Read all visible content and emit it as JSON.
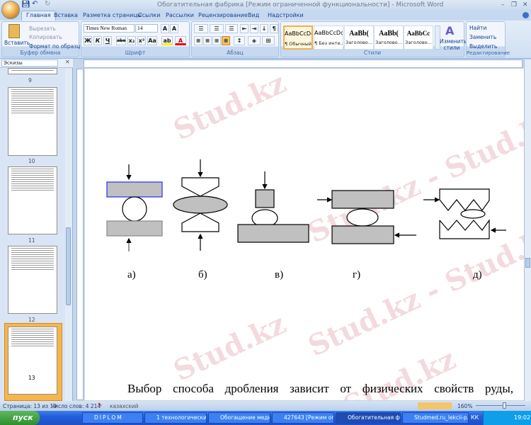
{
  "window": {
    "title": "Обогатительная фабрика [Режим ограниченной функциональности] - Microsoft Word",
    "minimize": "–",
    "restore": "❐",
    "close": "✕"
  },
  "tabs": [
    "Главная",
    "Вставка",
    "Разметка страницы",
    "Ссылки",
    "Рассылки",
    "Рецензирование",
    "Вид",
    "Надстройки"
  ],
  "ribbon": {
    "clipboard": {
      "label": "Буфер обмена",
      "paste": "Вставить",
      "cut": "Вырезать",
      "copy": "Копировать",
      "format_painter": "Формат по образцу"
    },
    "font": {
      "label": "Шрифт",
      "font_name": "Times New Roman",
      "font_size": "14",
      "bold": "Ж",
      "italic": "К",
      "underline": "Ч",
      "strike": "abe",
      "sub": "x₂",
      "sup": "x²",
      "case": "Aa"
    },
    "paragraph": {
      "label": "Абзац",
      "pilcrow": "¶"
    },
    "styles": {
      "label": "Стили",
      "items": [
        {
          "preview": "AaBbCcDc",
          "name": "¶ Обычный"
        },
        {
          "preview": "AaBbCcDc",
          "name": "¶ Без инте..."
        },
        {
          "preview": "AaBb(",
          "name": "Заголово..."
        },
        {
          "preview": "AaBb(",
          "name": "Заголово..."
        },
        {
          "preview": "AaBbCc",
          "name": "Заголово..."
        }
      ],
      "change_styles": "Изменить стили"
    },
    "editing": {
      "label": "Редактирование",
      "find": "Найти",
      "replace": "Заменить",
      "select": "Выделить"
    }
  },
  "thumbnails_pane": {
    "title": "Эскизы",
    "pages": [
      "9",
      "10",
      "11",
      "12",
      "13"
    ],
    "selected": "13"
  },
  "document": {
    "captions": [
      "а)",
      "б)",
      "в)",
      "г)",
      "д)"
    ],
    "body_text": "Выбор способа дробления зависит от физических свойств руды,",
    "watermark": "Stud.kz",
    "watermark2": "Stud.kz - Stud.kz"
  },
  "statusbar": {
    "page": "Страница: 13 из 19",
    "words": "Число слов: 4 214",
    "language": "казахский",
    "zoom": "160%"
  },
  "taskbar": {
    "start": "пуск",
    "tasks": [
      "DIPLOM",
      "1 технологический...",
      "Обогащение медн...",
      "427643 [Режим огр...",
      "Обогатительная ф...",
      "Studmed.ru_lekcii-p..."
    ],
    "lang": "КК",
    "clock": "19:02"
  },
  "colors": {
    "accent": "#15428b",
    "selection": "#f7b64b",
    "shape_fill": "#c0c0c0"
  }
}
